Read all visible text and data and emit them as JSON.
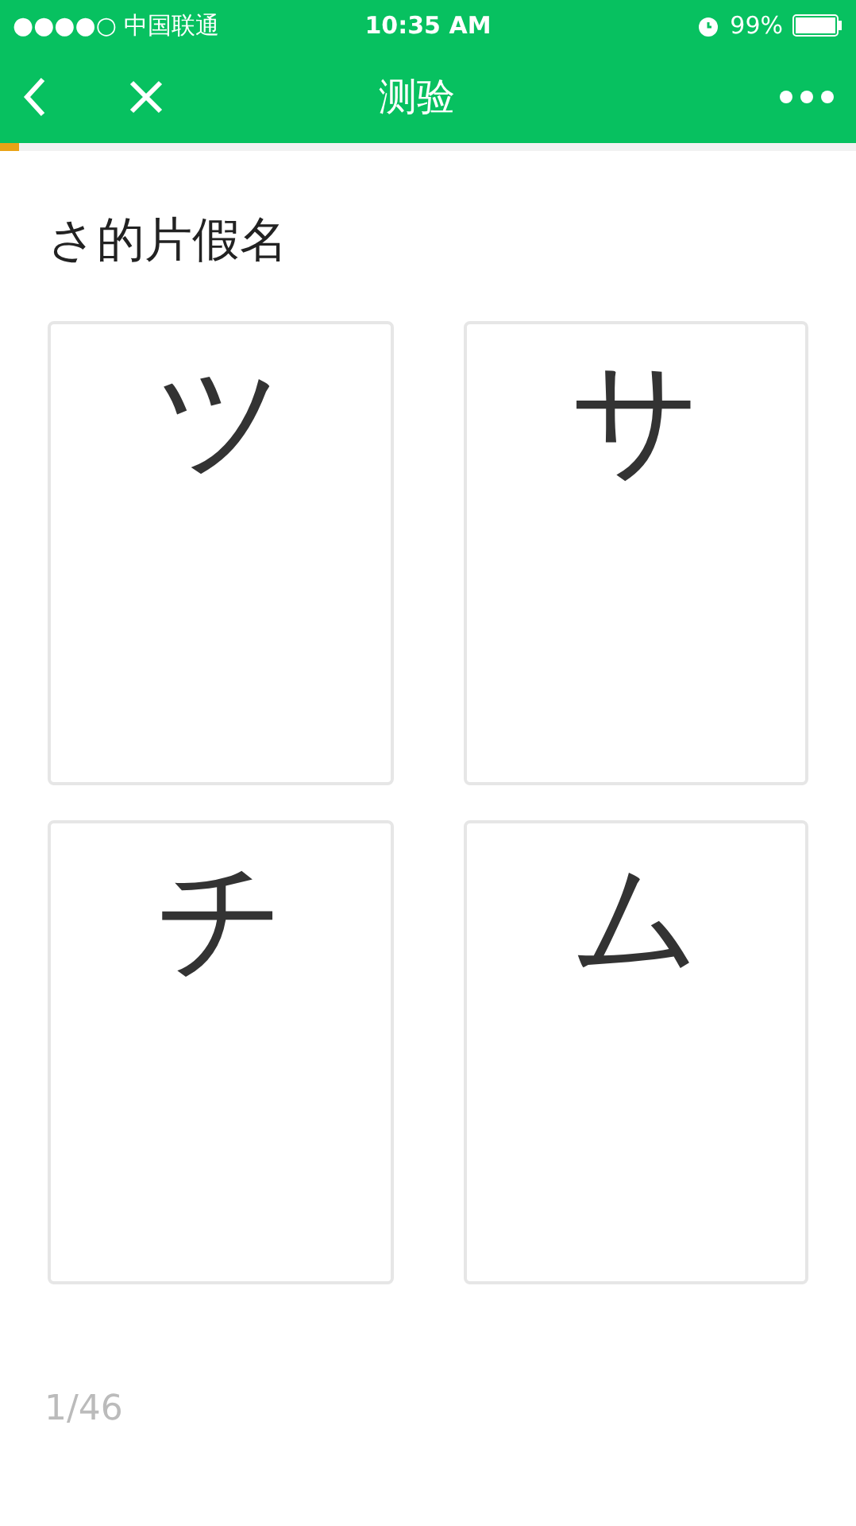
{
  "status_bar": {
    "carrier": "●●●●○ 中国联通",
    "time": "10:35 AM",
    "battery": "99%"
  },
  "nav": {
    "title": "测验"
  },
  "progress": {
    "level": 0.022
  },
  "question": "さ的片假名",
  "options": [
    {
      "label": "ツ"
    },
    {
      "label": "サ"
    },
    {
      "label": "チ"
    },
    {
      "label": "ム"
    }
  ],
  "counter": "1/46"
}
